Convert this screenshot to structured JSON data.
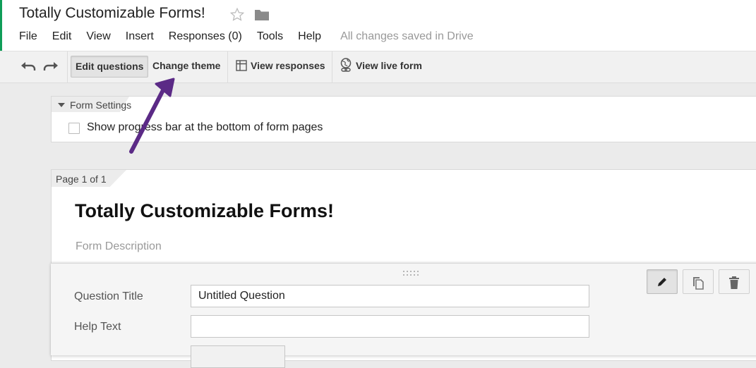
{
  "app": {
    "title": "Totally Customizable Forms!",
    "accent_color": "#0f9d58",
    "icons": [
      "star-icon",
      "folder-icon"
    ]
  },
  "menu": {
    "items": [
      "File",
      "Edit",
      "View",
      "Insert",
      "Responses (0)",
      "Tools",
      "Help"
    ],
    "status": "All changes saved in Drive"
  },
  "toolbar": {
    "undo_icon": "undo-icon",
    "redo_icon": "redo-icon",
    "edit_questions": "Edit questions",
    "change_theme": "Change theme",
    "view_responses": "View responses",
    "view_live_form": "View live form"
  },
  "settings": {
    "tab_label": "Form Settings",
    "progress_bar_label": "Show progress bar at the bottom of form pages",
    "progress_bar_checked": false
  },
  "page": {
    "tab_label": "Page 1 of 1",
    "form_title": "Totally Customizable Forms!",
    "form_description_placeholder": "Form Description"
  },
  "question": {
    "title_label": "Question Title",
    "title_value": "Untitled Question",
    "help_label": "Help Text",
    "help_value": "",
    "actions": [
      "pencil-icon",
      "duplicate-icon",
      "trash-icon"
    ]
  },
  "annotation": {
    "arrow_color": "#5b2a86"
  }
}
